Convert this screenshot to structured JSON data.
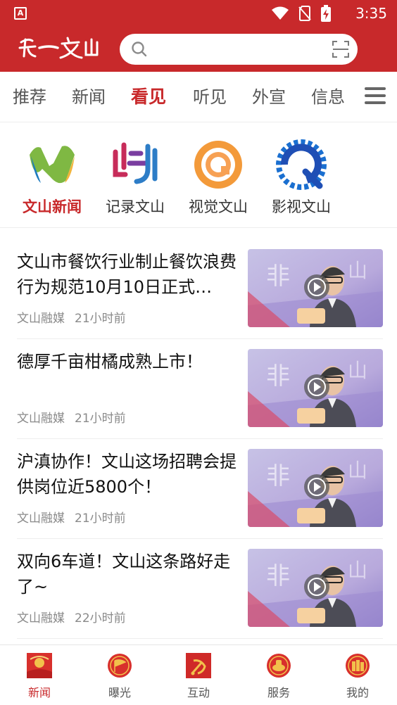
{
  "status": {
    "time": "3:35",
    "app_indicator": "A"
  },
  "header": {
    "logo_text": "第一文山",
    "search_placeholder": "",
    "search_value": ""
  },
  "tabs": [
    {
      "label": "推荐",
      "active": false
    },
    {
      "label": "新闻",
      "active": false
    },
    {
      "label": "看见",
      "active": true
    },
    {
      "label": "听见",
      "active": false
    },
    {
      "label": "外宣",
      "active": false
    },
    {
      "label": "信息",
      "active": false
    }
  ],
  "sub_channels": [
    {
      "label": "文山新闻",
      "icon": "wenshan-news-logo-icon",
      "active": true
    },
    {
      "label": "记录文山",
      "icon": "record-wenshan-logo-icon",
      "active": false
    },
    {
      "label": "视觉文山",
      "icon": "visual-wenshan-logo-icon",
      "active": false
    },
    {
      "label": "影视文山",
      "icon": "film-wenshan-logo-icon",
      "active": false
    }
  ],
  "news": [
    {
      "title": "文山市餐饮行业制止餐饮浪费行为规范10月10日正式…",
      "source": "文山融媒",
      "time": "21小时前"
    },
    {
      "title": "德厚千亩柑橘成熟上市！",
      "source": "文山融媒",
      "time": "21小时前"
    },
    {
      "title": "沪滇协作！文山这场招聘会提供岗位近5800个！",
      "source": "文山融媒",
      "time": "21小时前"
    },
    {
      "title": "双向6车道！文山这条路好走了~",
      "source": "文山融媒",
      "time": "22小时前"
    }
  ],
  "bottom_nav": [
    {
      "label": "新闻",
      "icon": "news-icon",
      "active": true
    },
    {
      "label": "曝光",
      "icon": "exposure-icon",
      "active": false
    },
    {
      "label": "互动",
      "icon": "interact-icon",
      "active": false
    },
    {
      "label": "服务",
      "icon": "service-icon",
      "active": false
    },
    {
      "label": "我的",
      "icon": "mine-icon",
      "active": false
    }
  ],
  "colors": {
    "brand_red": "#c8292b",
    "active_tab": "#c8292b",
    "meta_gray": "#8a8a8a"
  }
}
